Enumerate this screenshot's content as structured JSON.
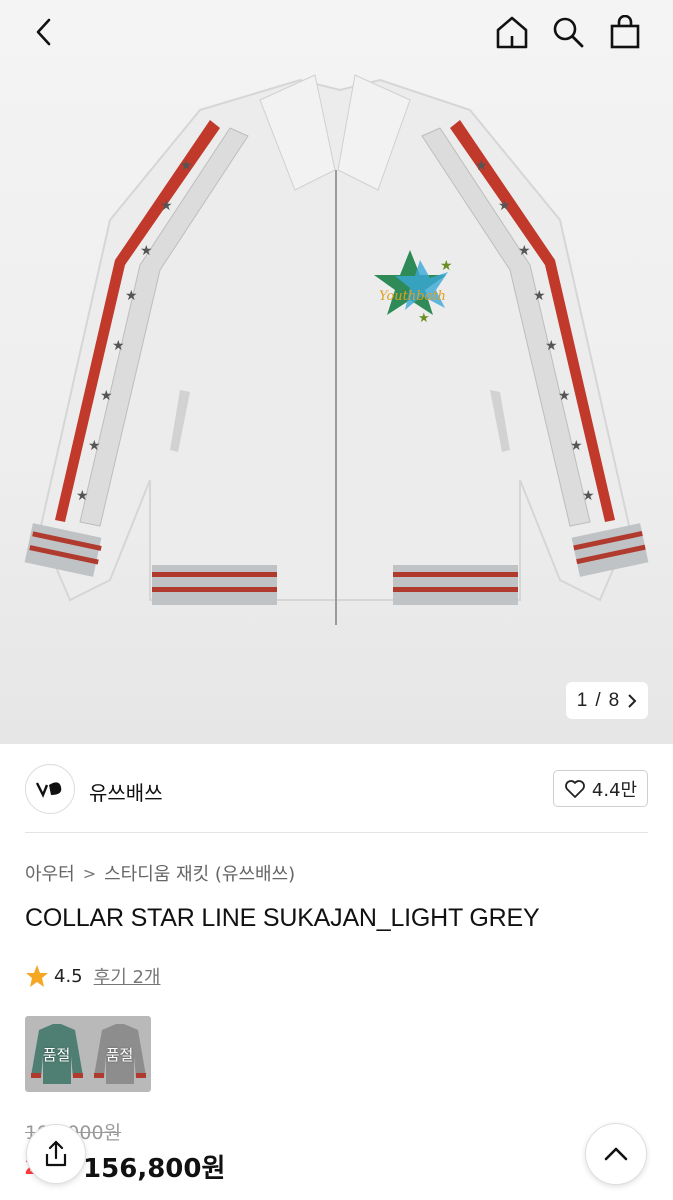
{
  "header": {
    "back_icon": "chevron-left-icon",
    "home_icon": "home-icon",
    "search_icon": "search-icon",
    "bag_icon": "shopping-bag-icon"
  },
  "gallery": {
    "current": "1",
    "separator": "/",
    "total": "8",
    "logo_text": "Youthbath",
    "image_subject": "light grey souvenir jacket with red/grey star sleeve stripes"
  },
  "brand": {
    "name": "유쓰배쓰",
    "like_count": "4.4만"
  },
  "breadcrumb": {
    "category": "아우터",
    "separator": ">",
    "subcategory": "스타디움 재킷 (유쓰배쓰)"
  },
  "product": {
    "title": "COLLAR STAR LINE SUKAJAN_LIGHT GREY",
    "rating": "4.5",
    "review_label": "후기 2개"
  },
  "variants": [
    {
      "label": "품절",
      "color": "#4f7f72"
    },
    {
      "label": "품절",
      "color": "#8d8d8d"
    }
  ],
  "pricing": {
    "original_price": "196,000원",
    "discount": "20%",
    "sale_price": "156,800원"
  },
  "colors": {
    "accent_red": "#ff3b3b",
    "star": "#f5a623"
  }
}
